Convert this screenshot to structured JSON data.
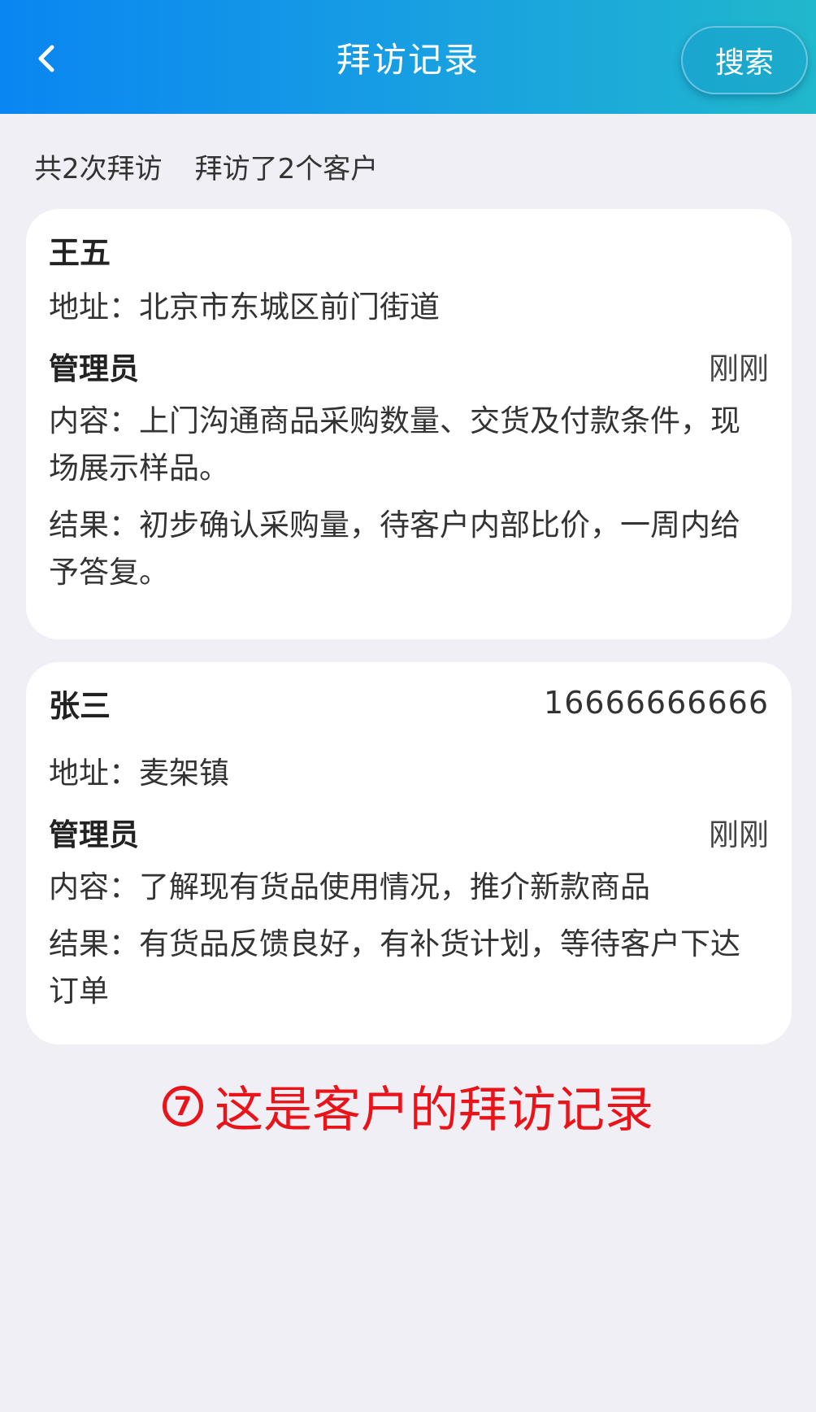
{
  "header": {
    "title": "拜访记录",
    "search_label": "搜索",
    "back_icon": "chevron-left-icon"
  },
  "summary": {
    "visit_count": "共2次拜访",
    "customer_count": "拜访了2个客户"
  },
  "records": [
    {
      "name": "王五",
      "phone": "",
      "address": "地址：北京市东城区前门街道",
      "manager": "管理员",
      "time": "刚刚",
      "content": "内容：上门沟通商品采购数量、交货及付款条件，现场展示样品。",
      "result": "结果：初步确认采购量，待客户内部比价，一周内给予答复。"
    },
    {
      "name": "张三",
      "phone": "16666666666",
      "address": "地址：麦架镇",
      "manager": "管理员",
      "time": "刚刚",
      "content": "内容：了解现有货品使用情况，推介新款商品",
      "result": "结果：有货品反馈良好，有补货计划，等待客户下达订单"
    }
  ],
  "annotation": {
    "number": "7",
    "text": "这是客户的拜访记录"
  },
  "colors": {
    "header_start": "#0a86f2",
    "header_end": "#20b8cc",
    "background": "#f0eff5",
    "annotation": "#e8141a"
  }
}
